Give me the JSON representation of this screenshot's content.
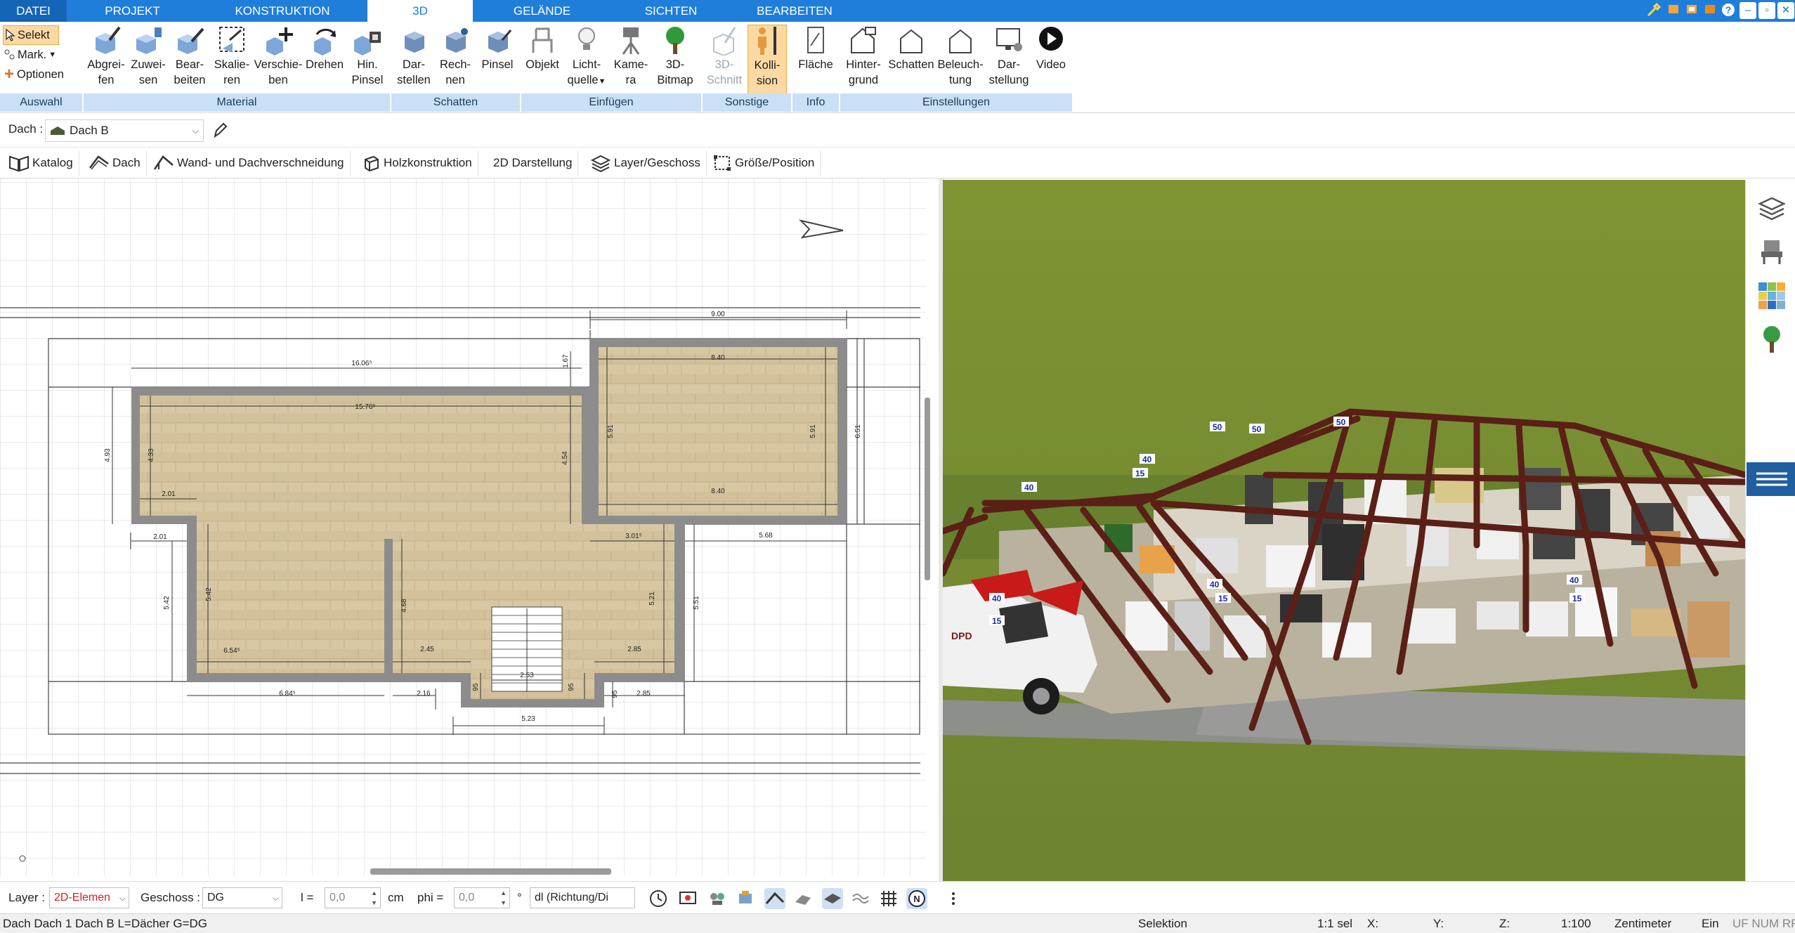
{
  "tabs": [
    {
      "label": "DATEI",
      "active": false
    },
    {
      "label": "PROJEKT",
      "active": false
    },
    {
      "label": "KONSTRUKTION",
      "active": false
    },
    {
      "label": "3D",
      "active": true
    },
    {
      "label": "GELÄNDE",
      "active": false
    },
    {
      "label": "SICHTEN",
      "active": false
    },
    {
      "label": "BEARBEITEN",
      "active": false
    }
  ],
  "ribbon": {
    "auswahl": {
      "selekt": "Selekt",
      "mark": "Mark.",
      "optionen": "Optionen",
      "footer": "Auswahl"
    },
    "material": {
      "footer": "Material",
      "buttons": [
        {
          "line1": "Abgrei-",
          "line2": "fen"
        },
        {
          "line1": "Zuwei-",
          "line2": "sen"
        },
        {
          "line1": "Bear-",
          "line2": "beiten"
        },
        {
          "line1": "Skalie-",
          "line2": "ren"
        },
        {
          "line1": "Verschie-",
          "line2": "ben"
        },
        {
          "line1": "Drehen",
          "line2": ""
        },
        {
          "line1": "Hin.",
          "line2": "Pinsel"
        }
      ]
    },
    "schatten": {
      "footer": "Schatten",
      "buttons": [
        {
          "line1": "Dar-",
          "line2": "stellen"
        },
        {
          "line1": "Rech-",
          "line2": "nen"
        },
        {
          "line1": "Pinsel",
          "line2": ""
        }
      ]
    },
    "einfuegen": {
      "footer": "Einfügen",
      "buttons": [
        {
          "line1": "Objekt",
          "line2": ""
        },
        {
          "line1": "Licht-",
          "line2": "quelle"
        },
        {
          "line1": "Kame-",
          "line2": "ra"
        },
        {
          "line1": "3D-",
          "line2": "Bitmap"
        }
      ]
    },
    "sonstige": {
      "footer": "Sonstige",
      "buttons": [
        {
          "line1": "3D-",
          "line2": "Schnitt"
        },
        {
          "line1": "Kolli-",
          "line2": "sion"
        }
      ]
    },
    "info": {
      "footer": "Info",
      "buttons": [
        {
          "line1": "Fläche",
          "line2": ""
        }
      ]
    },
    "einstellungen": {
      "footer": "Einstellungen",
      "buttons": [
        {
          "line1": "Hinter-",
          "line2": "grund"
        },
        {
          "line1": "Schatten",
          "line2": ""
        },
        {
          "line1": "Beleuch-",
          "line2": "tung"
        },
        {
          "line1": "Dar-",
          "line2": "stellung"
        },
        {
          "line1": "Video",
          "line2": ""
        }
      ]
    }
  },
  "selector": {
    "label": "Dach :",
    "value": "Dach B"
  },
  "toolbar": [
    {
      "label": "Katalog"
    },
    {
      "label": "Dach"
    },
    {
      "label": "Wand- und Dachverschneidung"
    },
    {
      "label": "Holzkonstruktion"
    },
    {
      "label": "2D Darstellung"
    },
    {
      "label": "Layer/Geschoss"
    },
    {
      "label": "Größe/Position"
    }
  ],
  "plan": {
    "dims": {
      "d900": "9.00",
      "d1606": "16.06⁵",
      "d1576": "15.76⁵",
      "d840a": "8.40",
      "d840b": "8.40",
      "d167": "1.67",
      "d591a": "5.91",
      "d591b": "5.91",
      "d651": "6.51",
      "d493": "4.93",
      "d433": "4.33",
      "d454": "4.54",
      "d201a": "2.01",
      "d201b": "2.01",
      "d301": "3.01⁵",
      "d568": "5.68",
      "d542a": "5.42",
      "d542b": "5.42",
      "d468": "4.68",
      "d521": "5.21",
      "d551": "5.51",
      "d654": "6.54⁵",
      "d245": "2.45",
      "d285a": "2.85",
      "d285b": "2.85",
      "d253": "2.53",
      "d95a": "95",
      "d95b": "95",
      "d95c": "95",
      "d684": "6.84⁵",
      "d216": "2.16",
      "d523": "5.23"
    }
  },
  "view3d": {
    "van_label": "DPD",
    "markers": [
      "50",
      "50",
      "50",
      "40",
      "15",
      "40",
      "40",
      "15",
      "40",
      "15",
      "40",
      "15"
    ]
  },
  "bottombar": {
    "layer_label": "Layer :",
    "layer_value": "2D-Elemen",
    "geschoss_label": "Geschoss :",
    "geschoss_value": "DG",
    "l_label": "l =",
    "l_value": "0,0",
    "l_unit": "cm",
    "phi_label": "phi =",
    "phi_value": "0,0",
    "phi_unit": "°",
    "dl_value": "dl (Richtung/Di"
  },
  "status": {
    "left": "Dach Dach 1 Dach B L=Dächer G=DG",
    "mode": "Selektion",
    "sel": "1:1 sel",
    "x": "X:",
    "y": "Y:",
    "z": "Z:",
    "scale": "1:100",
    "unit": "Zentimeter",
    "ein": "Ein",
    "flags": "UF NUM RF"
  },
  "colors": {
    "accent": "#1f7ed9",
    "floor": "#d7c7a3",
    "wall": "#8c8c8c",
    "grass": "#7a8f32",
    "timber": "#5a1f16"
  }
}
